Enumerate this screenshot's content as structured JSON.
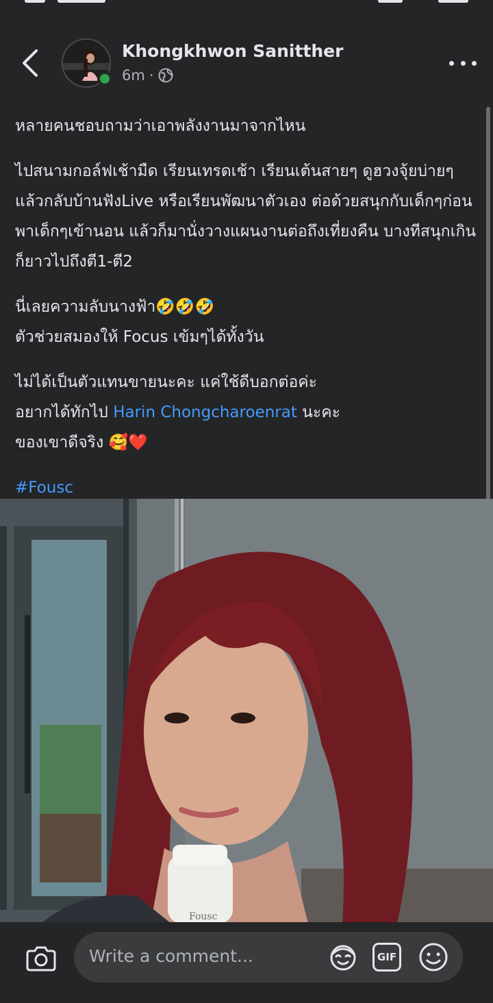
{
  "post": {
    "author": "Khongkhwon Sanitther",
    "time": "6m",
    "separator": "·",
    "privacy_icon": "globe-icon",
    "paragraph_1": "หลายคนชอบถามว่าเอาพลังงานมาจากไหน",
    "paragraph_2": "ไปสนามกอล์ฟเช้ามืด เรียนเทรดเช้า เรียนเต้นสายๆ ดูฮวงจุ้ยบ่ายๆ แล้วกลับบ้านฟังLive หรือเรียนพัฒนาตัวเอง ต่อด้วยสนุกกับเด็กๆก่อนพาเด็กๆเข้านอน แล้วก็มานั่งวางแผนงานต่อถึงเที่ยงคืน บางทีสนุกเกินก็ยาวไปถึงตี1-ตี2",
    "paragraph_3_line_1": "นี่เลยความลับนางฟ้า🤣🤣🤣",
    "paragraph_3_line_2": "ตัวช่วยสมองให้ Focus เข้มๆได้ทั้งวัน",
    "paragraph_4_line_1": "ไม่ได้เป็นตัวแทนขายนะคะ แค่ใช้ดีบอกต่อค่ะ",
    "paragraph_4_line_2_prefix": "อยากได้ทักไป ",
    "mention": "Harin Chongcharoenrat",
    "paragraph_4_line_2_suffix": " นะคะ",
    "paragraph_4_line_3": "ของเขาดีจริง 🥰❤️",
    "hashtag": "#Fousc",
    "photo_bottle_label": "Fousc"
  },
  "comment_bar": {
    "placeholder": "Write a comment...",
    "gif_label": "GIF"
  },
  "colors": {
    "background": "#242526",
    "text": "#e4e6eb",
    "secondary_text": "#b0b3b8",
    "link": "#4599ff",
    "online": "#31a24c",
    "input_bg": "#3a3b3c"
  }
}
